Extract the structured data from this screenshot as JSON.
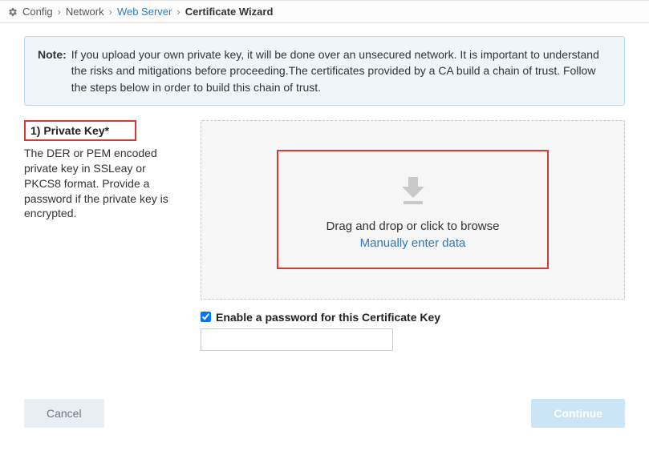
{
  "breadcrumb": {
    "items": [
      {
        "label": "Config",
        "type": "text"
      },
      {
        "label": "Network",
        "type": "text"
      },
      {
        "label": "Web Server",
        "type": "link"
      },
      {
        "label": "Certificate Wizard",
        "type": "current"
      }
    ]
  },
  "note": {
    "label": "Note:",
    "text": "If you upload your own private key, it will be done over an unsecured network. It is important to understand the risks and mitigations before proceeding.The certificates provided by a CA build a chain of trust. Follow the steps below in order to build this chain of trust."
  },
  "step": {
    "title": "1) Private Key*",
    "description": "The DER or PEM encoded private key in SSLeay or PKCS8 format. Provide a password if the private key is encrypted."
  },
  "dropzone": {
    "text": "Drag and drop or click to browse",
    "link": "Manually enter data"
  },
  "password": {
    "checkbox_label": "Enable a password for this Certificate Key",
    "checked": true,
    "value": ""
  },
  "buttons": {
    "cancel": "Cancel",
    "continue": "Continue"
  },
  "colors": {
    "highlight": "#d63b2f",
    "link": "#2a7bbf",
    "note_bg": "#eef6fc"
  }
}
